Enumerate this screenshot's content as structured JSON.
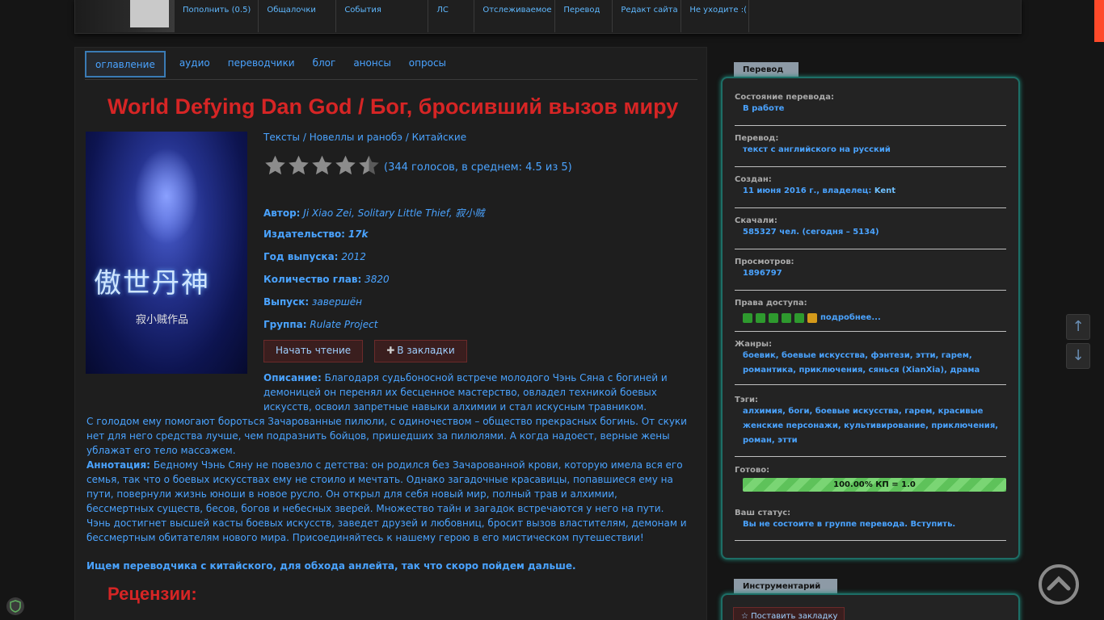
{
  "topnav": {
    "items": [
      "Пополнить (0.5)",
      "Общалочки",
      "События",
      "ЛС",
      "Отслеживаемое",
      "Перевод",
      "Редакт сайта",
      "Не уходите :("
    ]
  },
  "tabs": [
    "оглавление",
    "аудио",
    "переводчики",
    "блог",
    "анонсы",
    "опросы"
  ],
  "book": {
    "title": "World Defying Dan God / Бог, бросивший вызов миру",
    "cover_title": "傲世丹神",
    "cover_sub": "寂小贼作品",
    "breadcrumb": {
      "a": "Тексты",
      "b": "Новеллы и ранобэ",
      "c": "Китайские",
      "sep": " / "
    },
    "rating_text": "(344 голосов, в среднем: 4.5 из 5)",
    "rating_value": 4.5,
    "rating_max": 5,
    "meta": [
      {
        "label": "Автор:",
        "value": "Ji Xiao Zei, Solitary Little Thief, 寂小贼"
      },
      {
        "label": "Издательство:",
        "value": "17k"
      },
      {
        "label": "Год выпуска:",
        "value": "2012"
      },
      {
        "label": "Количество глав:",
        "value": "3820"
      },
      {
        "label": "Выпуск:",
        "value": "завершён"
      },
      {
        "label": "Группа:",
        "value": "Rulate Project"
      }
    ],
    "btn_read": "Начать чтение",
    "btn_bookmark": "В закладки",
    "desc_label": "Описание:",
    "desc_text": "Благодаря судьбоносной встрече молодого Чэнь Сяна с богиней и демоницей он перенял их бесценное мастерство, овладел техникой боевых искусств, освоил запретные навыки алхимии и стал искусным травником.",
    "desc_text2": "С голодом ему помогают бороться Зачарованные пилюли, с одиночеством – общество прекрасных богинь. От скуки нет для него средства лучше, чем подразнить бойцов, пришедших за пилюлями. А когда надоест, верные жены ублажат его тело массажем.",
    "annotation_label": "Аннотация:",
    "annotation_text": "Бедному Чэнь Сяну не повезло с детства: он родился без Зачарованной крови, которую имела вся его семья, так что о боевых искусствах ему не стоило и мечтать. Однако загадочные красавицы, попавшиеся ему на пути, повернули жизнь юноши в новое русло. Он открыл для себя новый мир, полный трав и алхимии, бессмертных существ, бесов, богов и небесных зверей. Множество тайн и загадок встречаются у него на пути. Чэнь достигнет высшей касты боевых искусств, заведет друзей и любовниц, бросит вызов властителям, демонам и бессмертным обитателям нового мира. Присоединяйтесь к нашему герою в его мистическом путешествии!",
    "wanted": "Ищем переводчика с китайского, для обхода анлейта, так что скоро пойдем дальше.",
    "reviews": "Рецензии:"
  },
  "sidebar": {
    "tab": "Перевод",
    "status_label": "Состояние перевода:",
    "status_value": "В работе",
    "translation_label": "Перевод:",
    "translation_value": "текст с английского на русский",
    "created_label": "Создан:",
    "created_value": "11 июня 2016 г., владелец: ",
    "owner": "Kent",
    "downloads_label": "Скачали:",
    "downloads_value": "585327 чел. (сегодня – 5134)",
    "views_label": "Просмотров:",
    "views_value": "1896797",
    "access_label": "Права доступа:",
    "access_more": "подробнее...",
    "genres_label": "Жанры:",
    "genres_value": "боевик, боевые искусства, фэнтези, этти, гарем, романтика, приключения, сянься (XianXia), драма",
    "tags_label": "Тэги:",
    "tags_value": "алхимия, боги, боевые искусства, гарем, красивые женские персонажи, культивирование, приключения, роман, этти",
    "ready_label": "Готово:",
    "ready_value": "100.00% КП = 1.0",
    "ready_fraction": 1.0,
    "member_label": "Ваш статус:",
    "member_value": "Вы не состоите в группе перевода. Вступить.",
    "tools_tab": "Инструментарий",
    "add_bookmark": "☆ Поставить закладку"
  },
  "colors": {
    "accent": "#4aa3ff",
    "title": "#d62525",
    "frame": "#1d6e66",
    "progress": "#5ec25a"
  },
  "icons": [
    "arrow-up-icon",
    "arrow-down-icon",
    "chevron-up-circle-icon",
    "shield-icon",
    "star-icon",
    "plus-icon"
  ]
}
